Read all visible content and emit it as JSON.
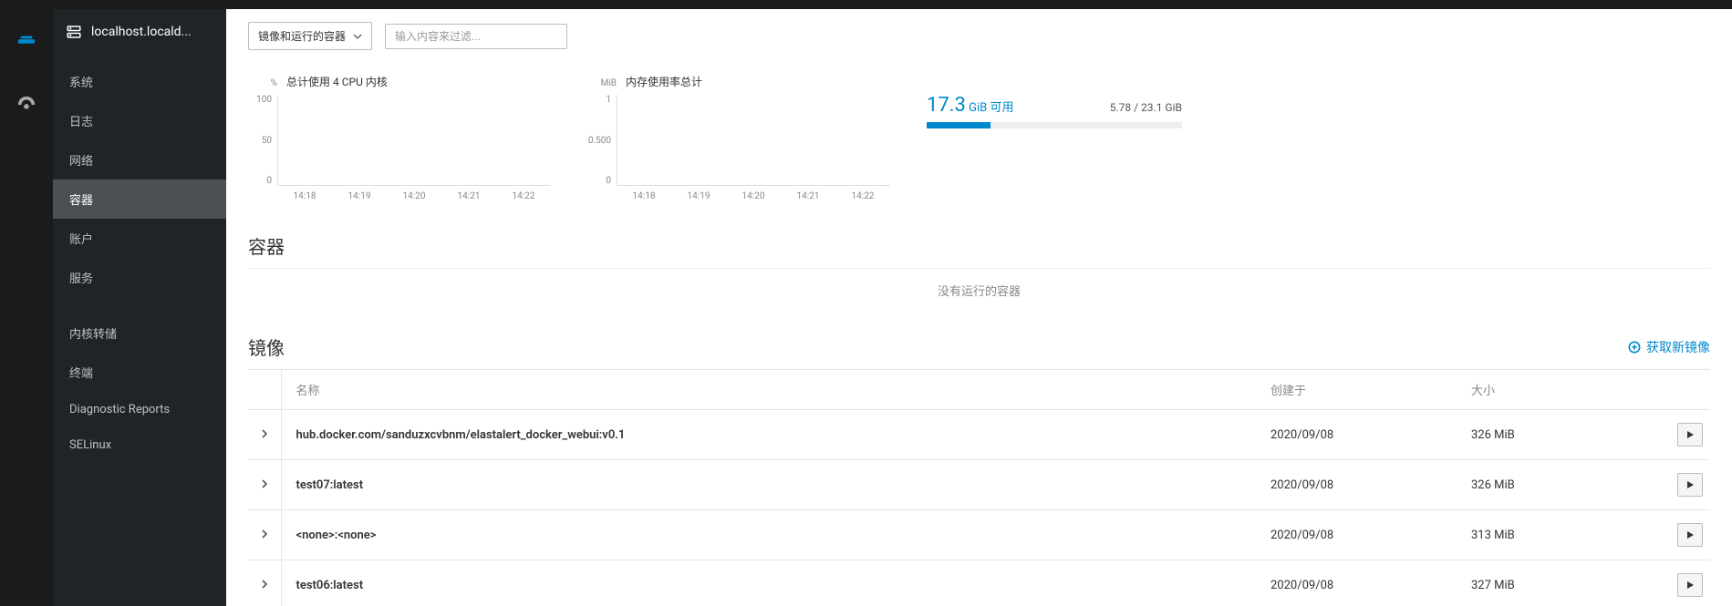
{
  "host_label": "localhost.locald...",
  "nav_rail": [
    "dashboard-icon",
    "gauge-icon"
  ],
  "sidebar": {
    "items": [
      {
        "label": "系统",
        "id": "system"
      },
      {
        "label": "日志",
        "id": "logs"
      },
      {
        "label": "网络",
        "id": "network"
      },
      {
        "label": "容器",
        "id": "containers",
        "active": true
      },
      {
        "label": "账户",
        "id": "accounts"
      },
      {
        "label": "服务",
        "id": "services"
      }
    ],
    "items2": [
      {
        "label": "内核转储",
        "id": "kdump"
      },
      {
        "label": "终端",
        "id": "terminal"
      },
      {
        "label": "Diagnostic Reports",
        "id": "diagnostic"
      },
      {
        "label": "SELinux",
        "id": "selinux"
      }
    ]
  },
  "toolbar": {
    "dropdown_label": "镜像和运行的容器",
    "filter_placeholder": "输入内容来过滤..."
  },
  "chart_data": [
    {
      "type": "line",
      "title": "总计使用 4 CPU 内核",
      "unit": "%",
      "yticks": [
        "100",
        "50",
        "0"
      ],
      "xticks": [
        "14:18",
        "14:19",
        "14:20",
        "14:21",
        "14:22"
      ],
      "ylim": [
        0,
        100
      ],
      "series": [
        {
          "name": "cpu",
          "values": [
            0,
            0,
            0,
            0,
            0
          ]
        }
      ]
    },
    {
      "type": "line",
      "title": "内存使用率总计",
      "unit": "MiB",
      "yticks": [
        "1",
        "0.500",
        "0"
      ],
      "xticks": [
        "14:18",
        "14:19",
        "14:20",
        "14:21",
        "14:22"
      ],
      "ylim": [
        0,
        1
      ],
      "series": [
        {
          "name": "mem",
          "values": [
            0,
            0,
            0,
            0,
            0
          ]
        }
      ]
    }
  ],
  "storage": {
    "available_value": "17.3",
    "available_unit": "GiB 可用",
    "used_text": "5.78 / 23.1 GiB",
    "used_fraction_pct": 25
  },
  "containers": {
    "title": "容器",
    "empty": "没有运行的容器"
  },
  "images": {
    "title": "镜像",
    "get_new_label": "获取新镜像",
    "columns": {
      "name": "名称",
      "created": "创建于",
      "size": "大小"
    },
    "rows": [
      {
        "name": "hub.docker.com/sanduzxcvbnm/elastalert_docker_webui:v0.1",
        "created": "2020/09/08",
        "size": "326 MiB"
      },
      {
        "name": "test07:latest",
        "created": "2020/09/08",
        "size": "326 MiB"
      },
      {
        "name": "<none>:<none>",
        "created": "2020/09/08",
        "size": "313 MiB"
      },
      {
        "name": "test06:latest",
        "created": "2020/09/08",
        "size": "327 MiB"
      }
    ]
  }
}
